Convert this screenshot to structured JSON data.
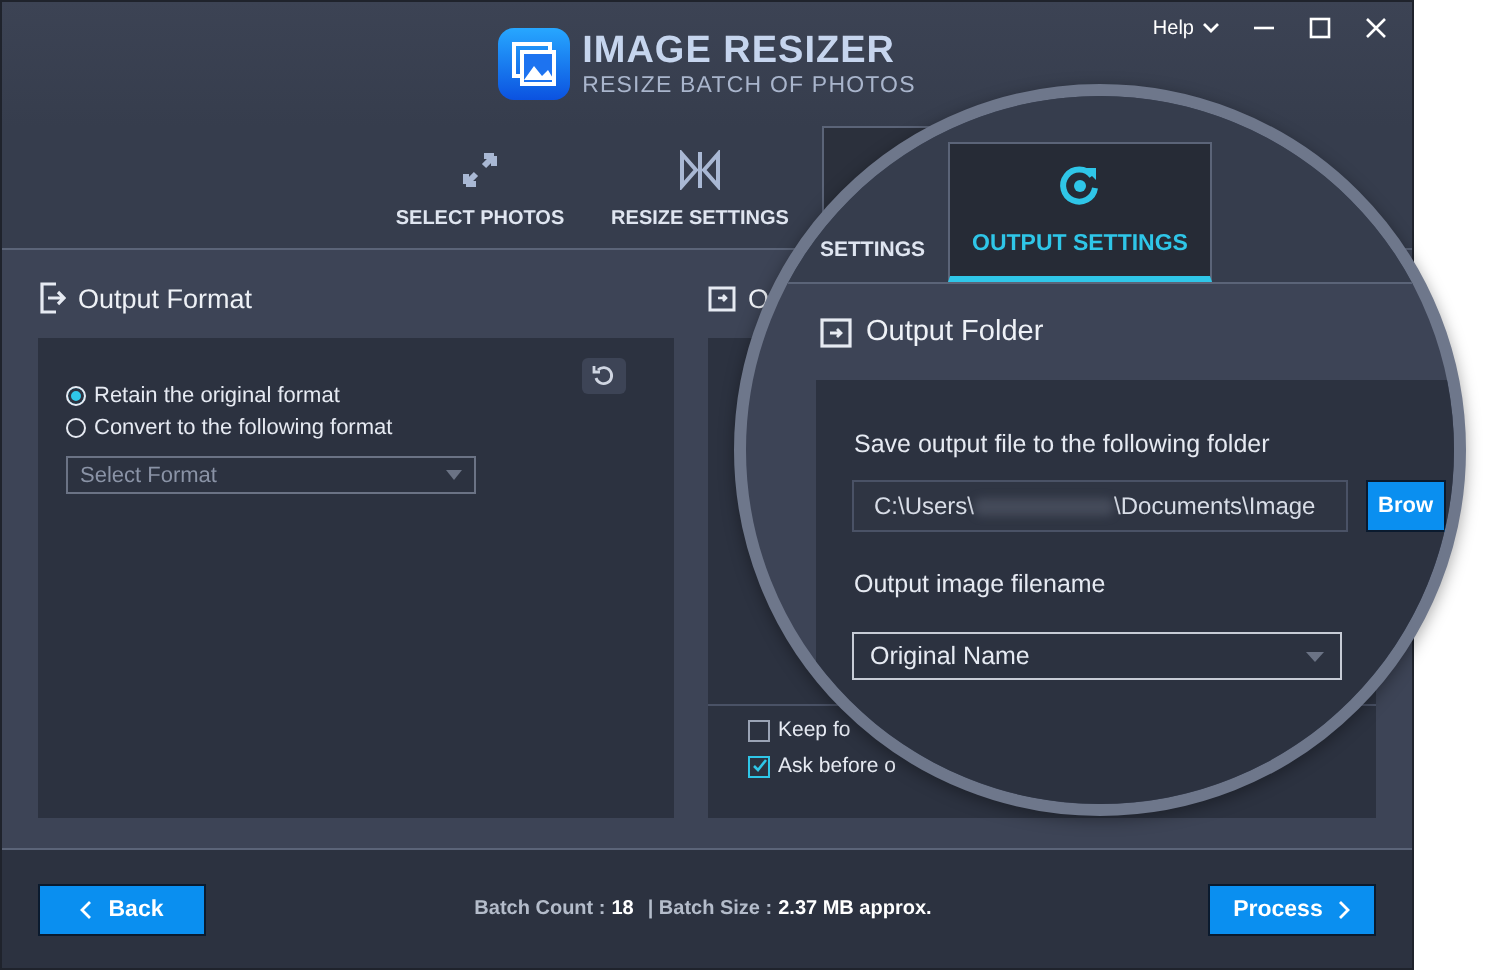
{
  "window": {
    "title": "IMAGE RESIZER",
    "subtitle": "RESIZE BATCH OF PHOTOS",
    "help": "Help"
  },
  "tabs": [
    {
      "label": "SELECT PHOTOS",
      "selected": false
    },
    {
      "label": "RESIZE SETTINGS",
      "selected": false
    }
  ],
  "output_format": {
    "title": "Output Format",
    "options": [
      {
        "label": "Retain the original format",
        "selected": true
      },
      {
        "label": "Convert to the following format",
        "selected": false
      }
    ],
    "format_select": {
      "placeholder": "Select Format"
    }
  },
  "output_folder_behind": {
    "title": "O",
    "options": [
      {
        "label": "Keep fo",
        "checked": false
      },
      {
        "label": "Ask before o",
        "checked": true
      }
    ]
  },
  "magnifier": {
    "tabs": [
      {
        "label": "SETTINGS",
        "selected": false
      },
      {
        "label": "OUTPUT SETTINGS",
        "selected": true
      }
    ],
    "title": "Output Folder",
    "folder_label": "Save output file to the following folder",
    "folder_path_start": "C:\\Users\\",
    "folder_path_end": "\\Documents\\Image",
    "browse_button": "Brow",
    "filename_label": "Output image filename",
    "filename_select": "Original Name"
  },
  "footer": {
    "back": "Back",
    "batch_count_label": "Batch Count :",
    "batch_count": "18",
    "batch_size_label": "| Batch Size :",
    "batch_size": "2.37 MB approx.",
    "process": "Process"
  }
}
